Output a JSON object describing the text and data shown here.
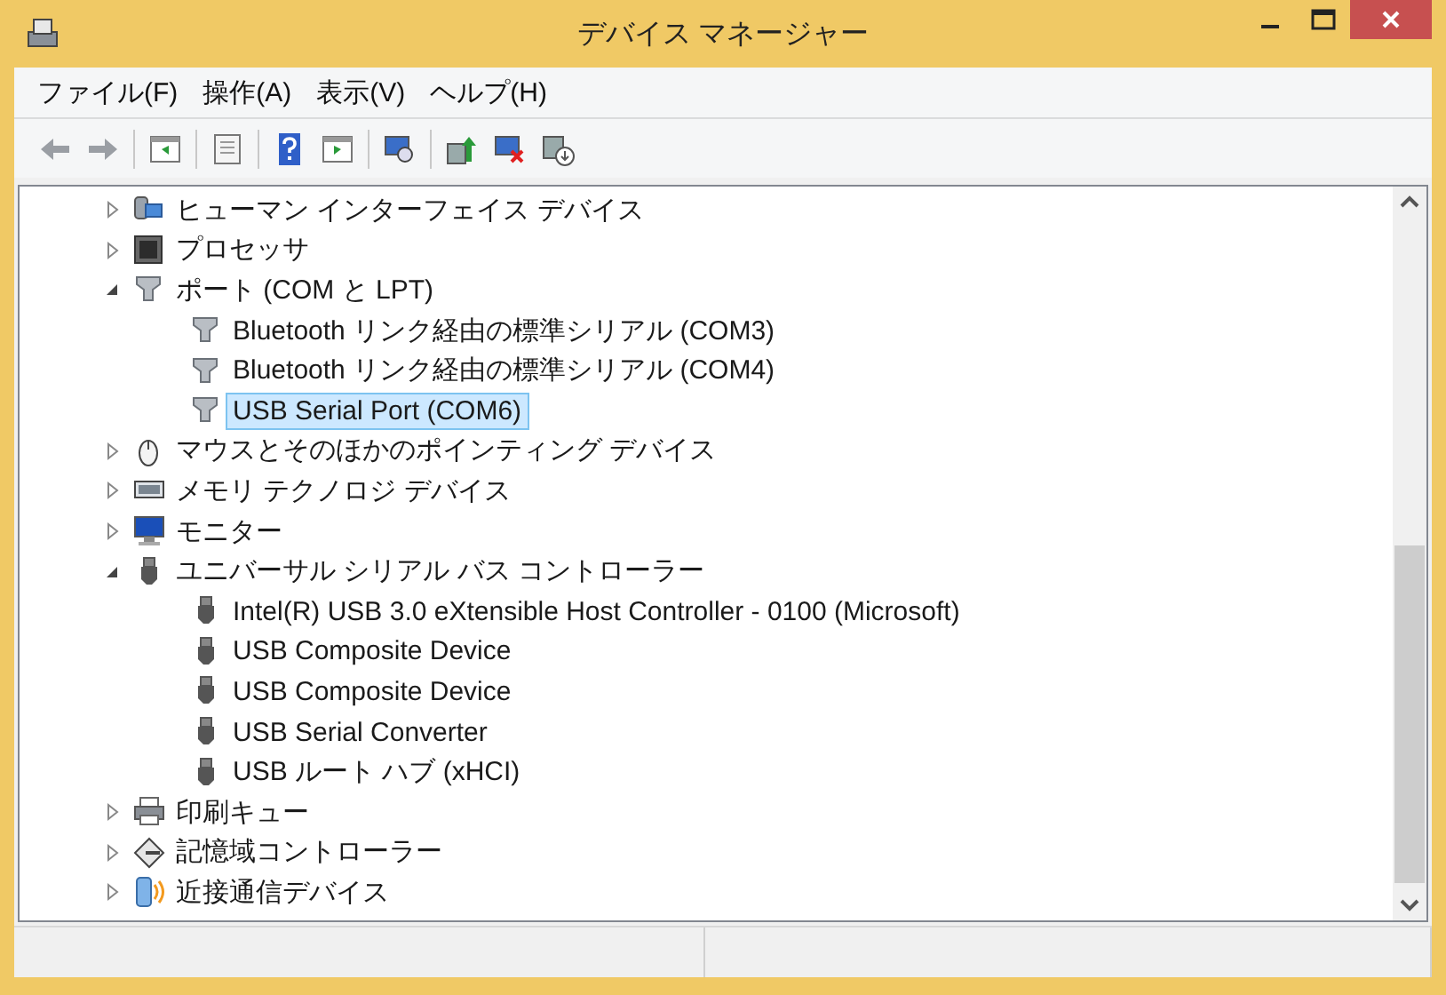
{
  "window": {
    "title": "デバイス マネージャー"
  },
  "menu": [
    {
      "label": "ファイル(F)"
    },
    {
      "label": "操作(A)"
    },
    {
      "label": "表示(V)"
    },
    {
      "label": "ヘルプ(H)"
    }
  ],
  "tree": [
    {
      "label": "ヒューマン インターフェイス デバイス",
      "kind": "hid",
      "expanded": false,
      "selected": false
    },
    {
      "label": "プロセッサ",
      "kind": "processor",
      "expanded": false,
      "selected": false
    },
    {
      "label": "ポート (COM と LPT)",
      "kind": "port",
      "expanded": true,
      "selected": false,
      "children": [
        {
          "label": "Bluetooth リンク経由の標準シリアル (COM3)",
          "kind": "port",
          "selected": false
        },
        {
          "label": "Bluetooth リンク経由の標準シリアル (COM4)",
          "kind": "port",
          "selected": false
        },
        {
          "label": "USB Serial Port (COM6)",
          "kind": "port",
          "selected": true
        }
      ]
    },
    {
      "label": "マウスとそのほかのポインティング デバイス",
      "kind": "mouse",
      "expanded": false,
      "selected": false
    },
    {
      "label": "メモリ テクノロジ デバイス",
      "kind": "memory",
      "expanded": false,
      "selected": false
    },
    {
      "label": "モニター",
      "kind": "monitor",
      "expanded": false,
      "selected": false
    },
    {
      "label": "ユニバーサル シリアル バス コントローラー",
      "kind": "usb",
      "expanded": true,
      "selected": false,
      "children": [
        {
          "label": "Intel(R) USB 3.0 eXtensible Host Controller - 0100 (Microsoft)",
          "kind": "usb",
          "selected": false
        },
        {
          "label": "USB Composite Device",
          "kind": "usb",
          "selected": false
        },
        {
          "label": "USB Composite Device",
          "kind": "usb",
          "selected": false
        },
        {
          "label": "USB Serial Converter",
          "kind": "usb",
          "selected": false
        },
        {
          "label": "USB ルート ハブ (xHCI)",
          "kind": "usb",
          "selected": false
        }
      ]
    },
    {
      "label": "印刷キュー",
      "kind": "printer",
      "expanded": false,
      "selected": false
    },
    {
      "label": "記憶域コントローラー",
      "kind": "storage",
      "expanded": false,
      "selected": false
    },
    {
      "label": "近接通信デバイス",
      "kind": "proximity",
      "expanded": false,
      "selected": false
    }
  ]
}
